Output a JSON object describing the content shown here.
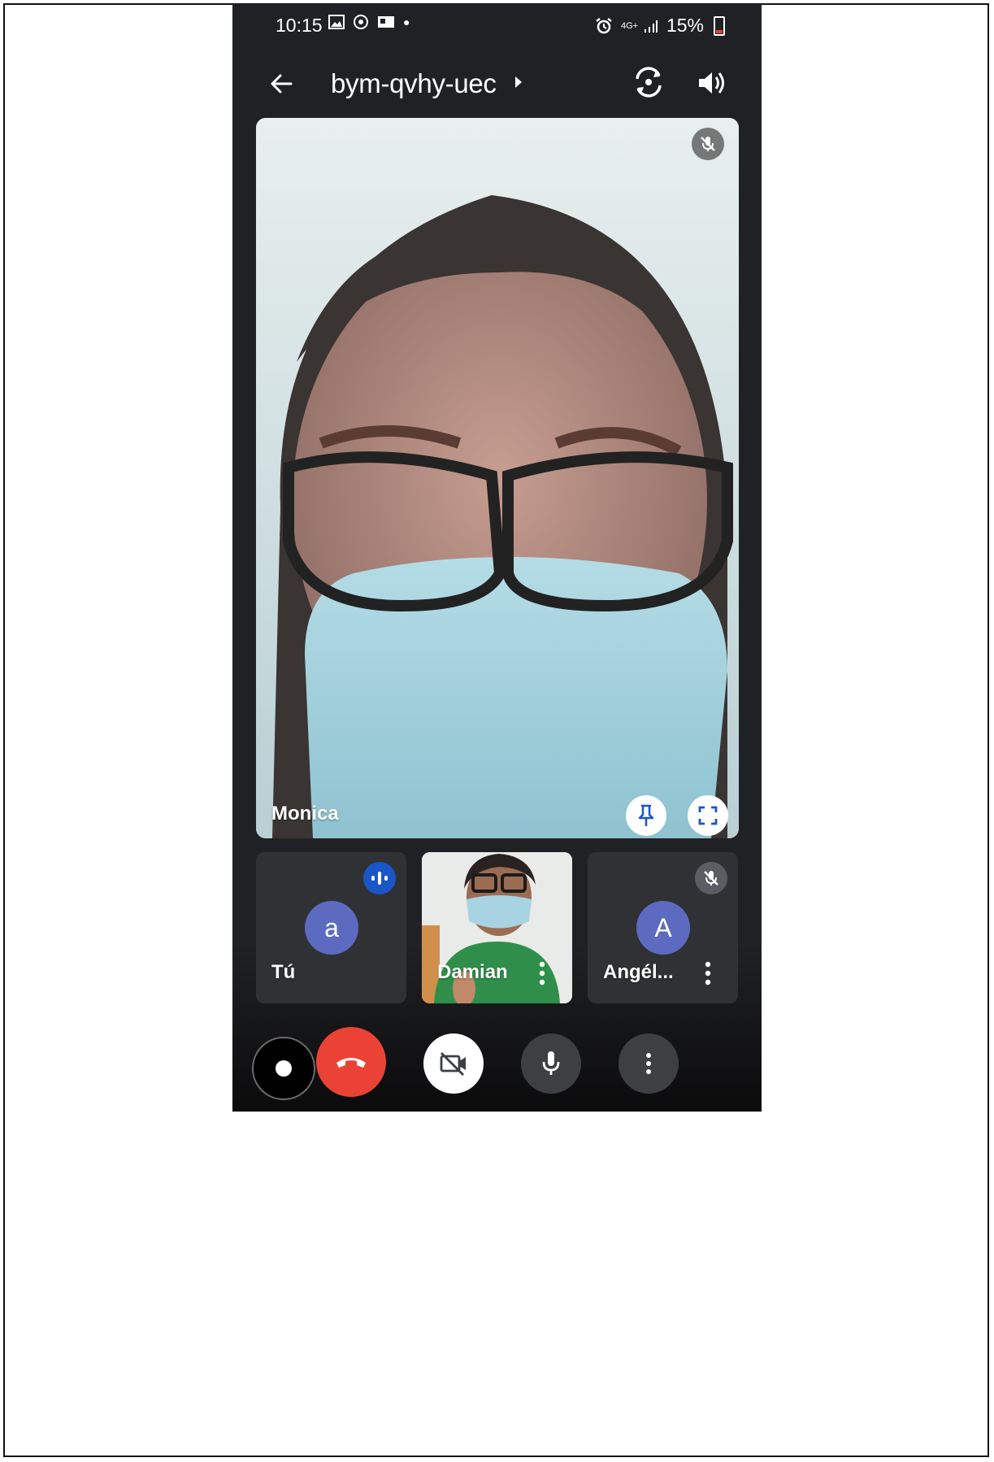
{
  "status_bar": {
    "time": "10:15",
    "signal_label": "4G+",
    "battery": "15%"
  },
  "header": {
    "meeting_code": "bym-qvhy-uec"
  },
  "main_participant": {
    "name": "Monica"
  },
  "participants": [
    {
      "name": "Tú",
      "avatar_letter": "a"
    },
    {
      "name": "Damian"
    },
    {
      "name": "Angél...",
      "avatar_letter": "A"
    }
  ],
  "colors": {
    "background": "#202124",
    "tile": "#303134",
    "avatar": "#5c6bc0",
    "end_call": "#ea4335",
    "speaking_indicator": "#1a56c7"
  },
  "icons": {
    "back": "arrow-left-icon",
    "flip_camera": "flip-camera-icon",
    "speaker": "speaker-icon",
    "mic_off": "mic-off-icon",
    "pin": "pin-icon",
    "fullscreen": "fullscreen-icon",
    "end_call": "phone-hangup-icon",
    "camera_off": "camera-off-icon",
    "mic": "mic-icon",
    "more": "more-vert-icon"
  }
}
